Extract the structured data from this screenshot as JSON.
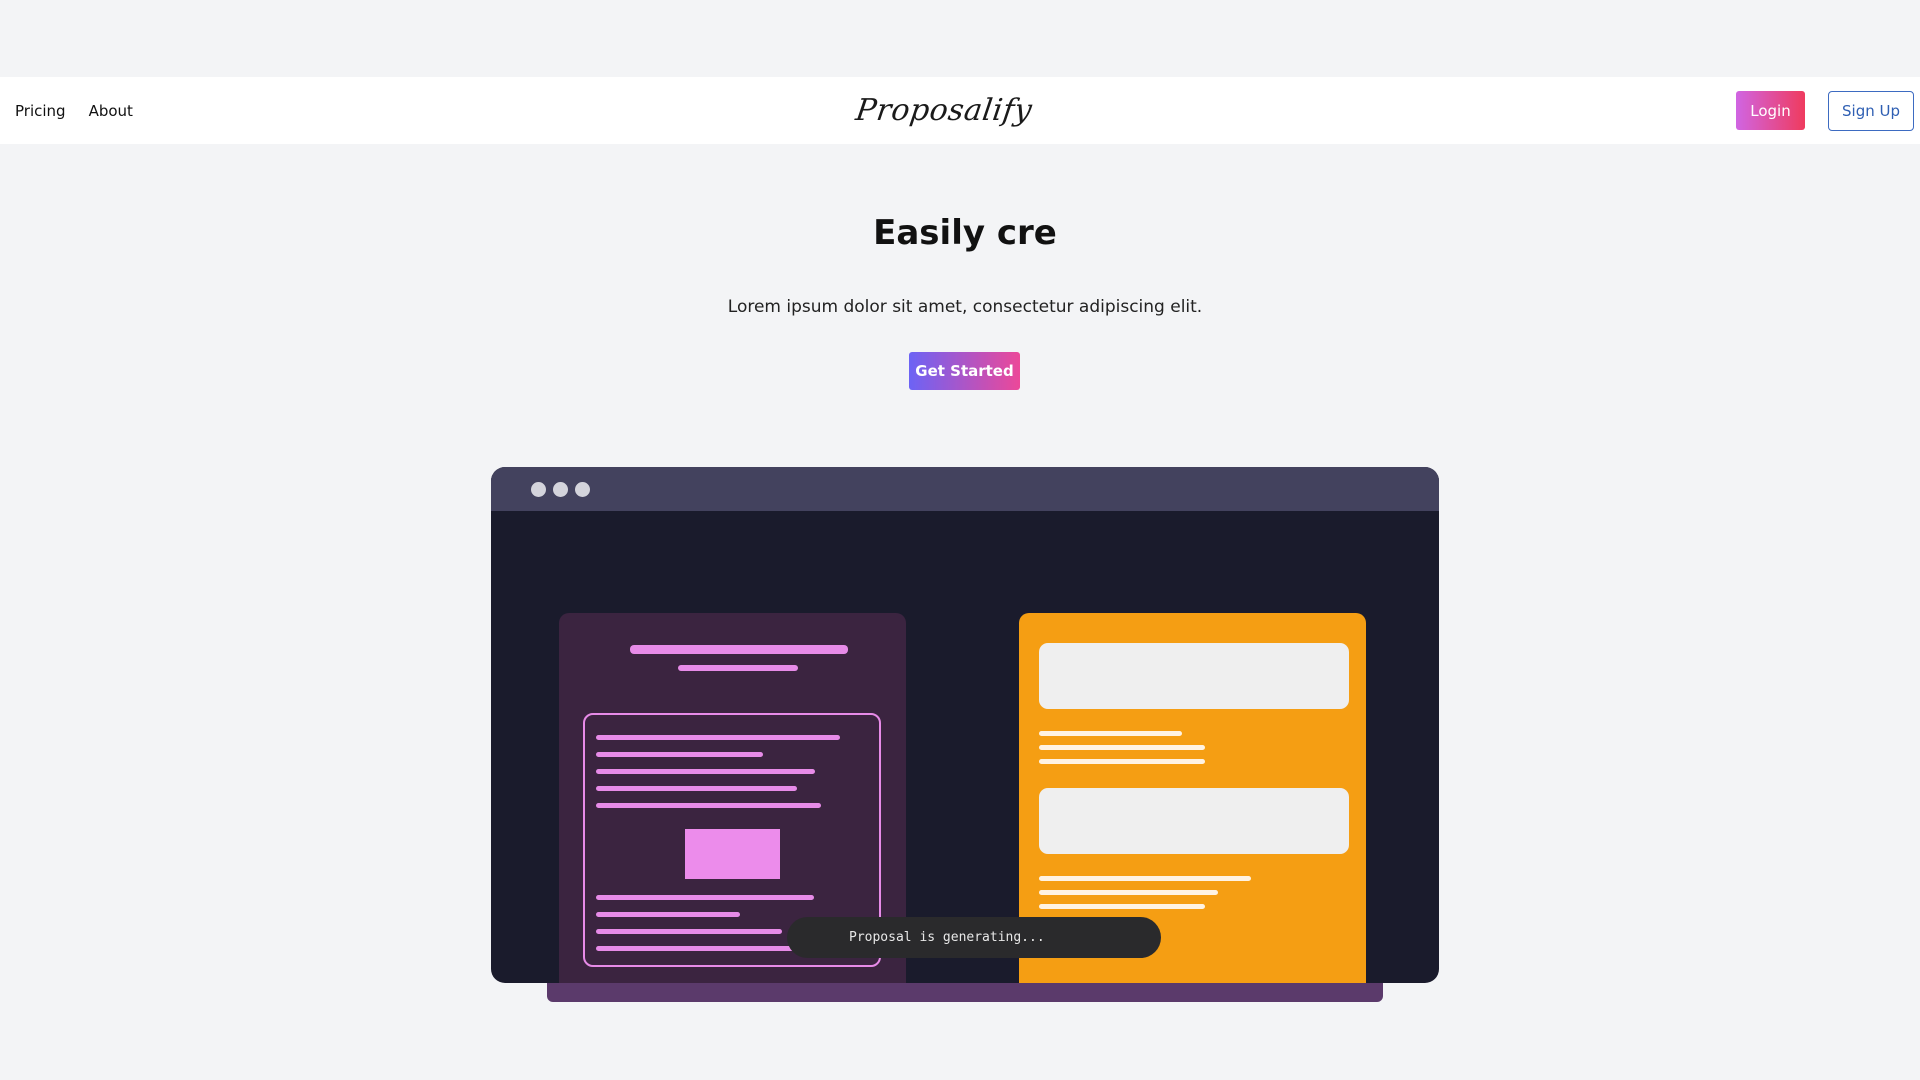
{
  "nav": {
    "links": [
      {
        "label": "Pricing"
      },
      {
        "label": "About"
      }
    ],
    "brand": "Proposalify",
    "login_label": "Login",
    "signup_label": "Sign Up"
  },
  "hero": {
    "title": "Easily cre",
    "subtitle": "Lorem ipsum dolor sit amet, consectetur adipiscing elit.",
    "cta_label": "Get Started"
  },
  "mockup": {
    "status_text": "Proposal is generating...",
    "colors": {
      "window_bg": "#1a1b2c",
      "window_bar": "#43425e",
      "left_panel": "#3b2440",
      "accent_pink": "#e78be8",
      "right_panel": "#f59e13"
    }
  },
  "colors": {
    "page_bg": "#f3f4f6",
    "login_gradient": [
      "#d065e3",
      "#ef3b5e"
    ],
    "cta_gradient": [
      "#6c63f5",
      "#ec4899"
    ],
    "signup_border": "#3d6bc1"
  }
}
